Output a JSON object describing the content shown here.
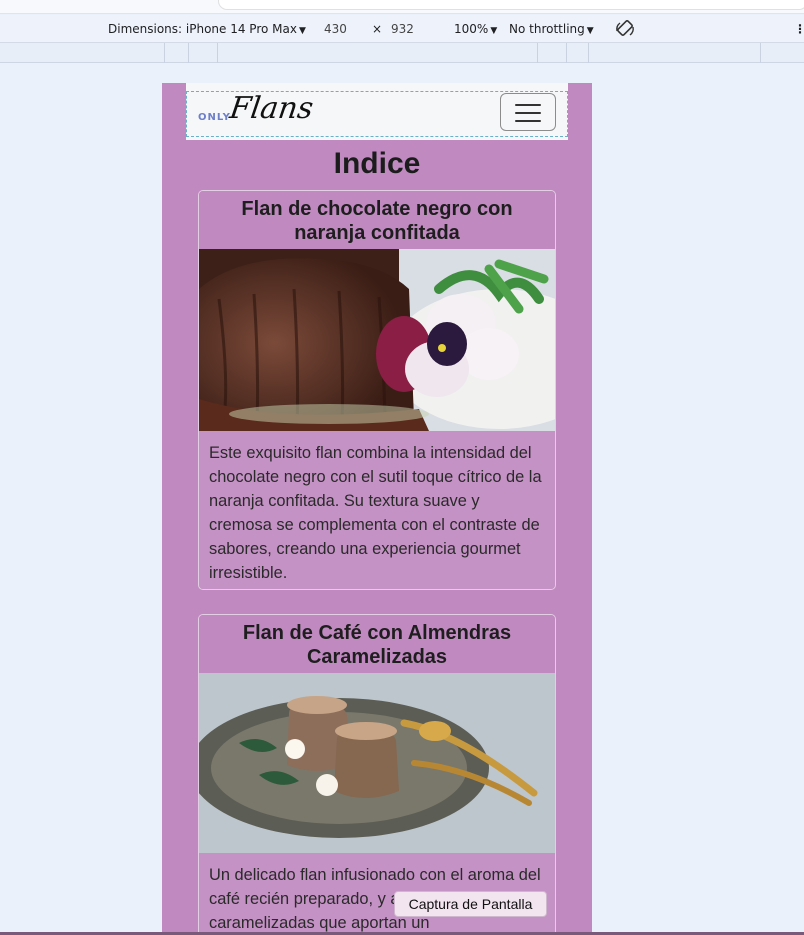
{
  "devtools": {
    "dimensions_label": "Dimensions: iPhone 14 Pro Max",
    "width_value": "430",
    "times_sign": "×",
    "height_value": "932",
    "zoom_label": "100%",
    "throttle_label": "No throttling",
    "more_label": "⋮"
  },
  "site": {
    "logo_small": "ONLY",
    "logo_main": "Flans",
    "page_title": "Indice"
  },
  "cards": [
    {
      "title": "Flan de chocolate negro con naranja confitada",
      "text": "Este exquisito flan combina la intensidad del chocolate negro con el sutil toque cítrico de la naranja confitada. Su textura suave y cremosa se complementa con el contraste de sabores, creando una experiencia gourmet irresistible."
    },
    {
      "title": "Flan de Café con Almendras Caramelizadas",
      "text": "Un delicado flan infusionado con el aroma del café recién preparado, y almendras caramelizadas que aportan un"
    }
  ],
  "tooltip": "Captura de Pantalla",
  "colors": {
    "page_bg": "#c08ac0",
    "navbar_bg": "#f6f7f9",
    "logo_accent": "#6d7fc9"
  }
}
